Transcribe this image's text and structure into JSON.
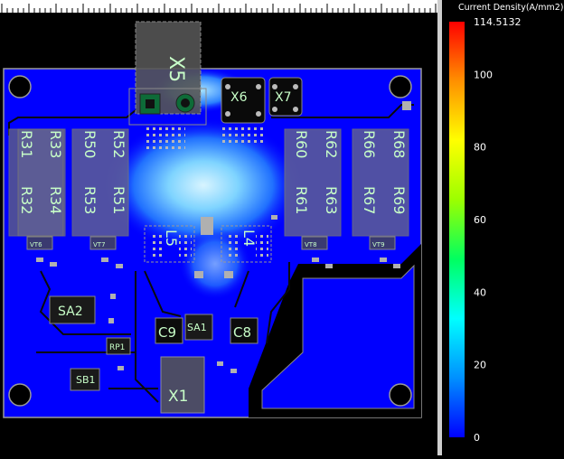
{
  "legend": {
    "title": "Current Density(A/mm2)",
    "max_label": "114.5132",
    "ticks": [
      {
        "value": 0,
        "label": "0"
      },
      {
        "value": 20,
        "label": "20"
      },
      {
        "value": 40,
        "label": "40"
      },
      {
        "value": 60,
        "label": "60"
      },
      {
        "value": 80,
        "label": "80"
      },
      {
        "value": 100,
        "label": "100"
      }
    ],
    "max_value": 114.5132,
    "colors": [
      "#0000ff",
      "#0090ff",
      "#00ffff",
      "#00ff60",
      "#9cff00",
      "#ffff00",
      "#ff9000",
      "#ff0000"
    ]
  },
  "board": {
    "background_color": "#0000ff",
    "hot_color": "#c8f0ff",
    "labels": {
      "x5": "X5",
      "x6": "X6",
      "x7": "X7",
      "x1": "X1",
      "r31": "R31",
      "r33": "R33",
      "r32": "R32",
      "r34": "R34",
      "r50": "R50",
      "r52": "R52",
      "r53": "R53",
      "r51": "R51",
      "r60": "R60",
      "r62": "R62",
      "r61": "R61",
      "r63": "R63",
      "r66": "R66",
      "r68": "R68",
      "r67": "R67",
      "r69": "R69",
      "l5": "L5",
      "l4": "L4",
      "sa2": "SA2",
      "sa1": "SA1",
      "c9": "C9",
      "c8": "C8",
      "rp1": "RP1",
      "sb1": "SB1",
      "vt6": "VT6",
      "vt7": "VT7",
      "vt8": "VT8",
      "vt9": "VT9"
    }
  }
}
